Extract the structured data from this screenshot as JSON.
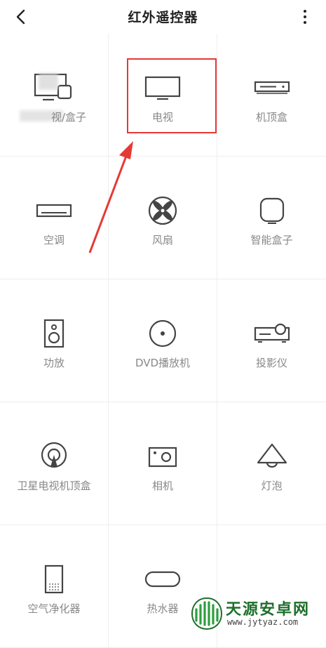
{
  "header": {
    "title": "红外遥控器"
  },
  "devices": [
    {
      "label": "视/盒子",
      "icon": "tv-box-icon"
    },
    {
      "label": "电视",
      "icon": "tv-icon"
    },
    {
      "label": "机顶盒",
      "icon": "set-top-box-icon"
    },
    {
      "label": "空调",
      "icon": "air-conditioner-icon"
    },
    {
      "label": "风扇",
      "icon": "fan-icon"
    },
    {
      "label": "智能盒子",
      "icon": "smart-box-icon"
    },
    {
      "label": "功放",
      "icon": "amplifier-icon"
    },
    {
      "label": "DVD播放机",
      "icon": "dvd-player-icon"
    },
    {
      "label": "投影仪",
      "icon": "projector-icon"
    },
    {
      "label": "卫星电视机顶盒",
      "icon": "satellite-tv-icon"
    },
    {
      "label": "相机",
      "icon": "camera-icon"
    },
    {
      "label": "灯泡",
      "icon": "light-bulb-icon"
    },
    {
      "label": "空气净化器",
      "icon": "air-purifier-icon"
    },
    {
      "label": "热水器",
      "icon": "water-heater-icon"
    }
  ],
  "watermark": {
    "brand": "天源安卓网",
    "url": "www.jytyaz.com"
  },
  "colors": {
    "icon": "#444444",
    "label": "#888888",
    "highlight": "#e53935",
    "watermark_green": "#1d6f2a"
  }
}
